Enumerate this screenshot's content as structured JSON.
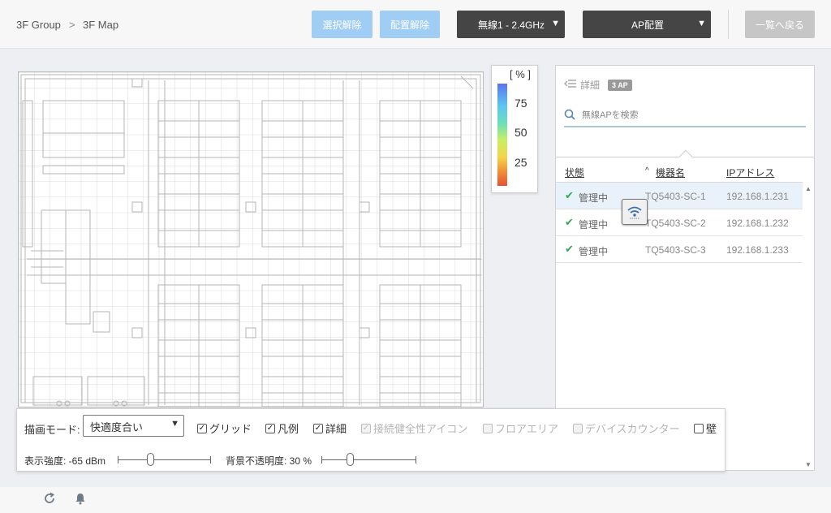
{
  "breadcrumb": {
    "group": "3F Group",
    "separator": ">",
    "map": "3F Map"
  },
  "toolbar": {
    "deselect": "選択解除",
    "unplace": "配置解除",
    "band": "無線1 - 2.4GHz",
    "ap_place": "AP配置",
    "back": "一覧へ戻る"
  },
  "legend": {
    "unit": "[ % ]",
    "ticks": [
      "75",
      "50",
      "25"
    ]
  },
  "panel": {
    "title": "詳細",
    "ap_count": "3 AP",
    "search_placeholder": "無線APを検索",
    "columns": {
      "status": "状態",
      "name": "機器名",
      "ip": "IPアドレス"
    },
    "rows": [
      {
        "status": "管理中",
        "name": "TQ5403-SC-1",
        "ip": "192.168.1.231"
      },
      {
        "status": "管理中",
        "name": "TQ5403-SC-2",
        "ip": "192.168.1.232"
      },
      {
        "status": "管理中",
        "name": "TQ5403-SC-3",
        "ip": "192.168.1.233"
      }
    ]
  },
  "controls": {
    "mode_label": "描画モード:",
    "mode_value": "快適度合い",
    "grid": "グリッド",
    "legend": "凡例",
    "detail": "詳細",
    "health_icon": "接続健全性アイコン",
    "floor_area": "フロアエリア",
    "device_counter": "デバイスカウンター",
    "wall": "壁",
    "strength_label": "表示強度: -65 dBm",
    "opacity_label": "背景不透明度: 30 %",
    "strength_level": 0.35,
    "opacity_level": 0.3
  },
  "colors": {
    "accent_light": "#9fcdf4",
    "dark": "#454545",
    "ok": "#2fa84f"
  }
}
